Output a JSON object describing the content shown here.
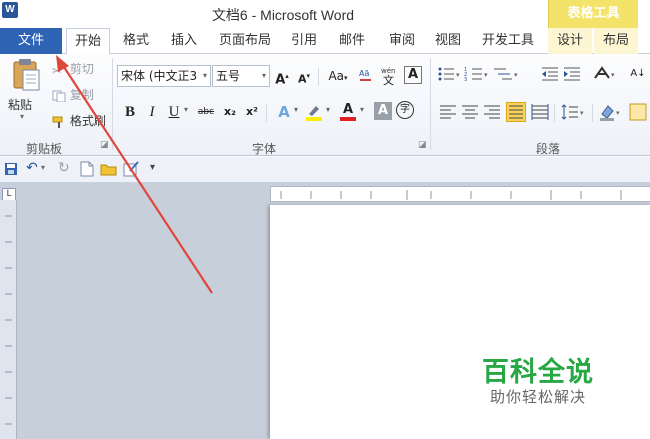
{
  "titlebar": {
    "app_icon": "W",
    "title": "文档6 - Microsoft Word",
    "context_group": "表格工具"
  },
  "tabs": [
    "文件",
    "开始",
    "格式",
    "插入",
    "页面布局",
    "引用",
    "邮件",
    "审阅",
    "视图",
    "开发工具",
    "设计",
    "布局"
  ],
  "clipboard": {
    "paste": "粘贴",
    "cut": "剪切",
    "copy": "复制",
    "format_painter": "格式刷",
    "group_label": "剪贴板"
  },
  "font": {
    "font_name": "宋体 (中文正3",
    "font_size": "五号",
    "grow": "A",
    "shrink": "A",
    "case": "Aa",
    "bold": "B",
    "italic": "I",
    "underline": "U",
    "strike": "abc",
    "subscript": "x₂",
    "superscript": "x²",
    "highlight": "A",
    "font_color": "A",
    "char_shade": "A",
    "enclose": "字",
    "group_label": "字体"
  },
  "paragraph": {
    "group_label": "段落"
  },
  "watermark": {
    "main": "百科全说",
    "sub": "助你轻松解决"
  },
  "colors": {
    "file_tab": "#2f64b5",
    "context_tab": "#f4e36a",
    "arrow": "#e0463c",
    "watermark": "#28a745"
  }
}
